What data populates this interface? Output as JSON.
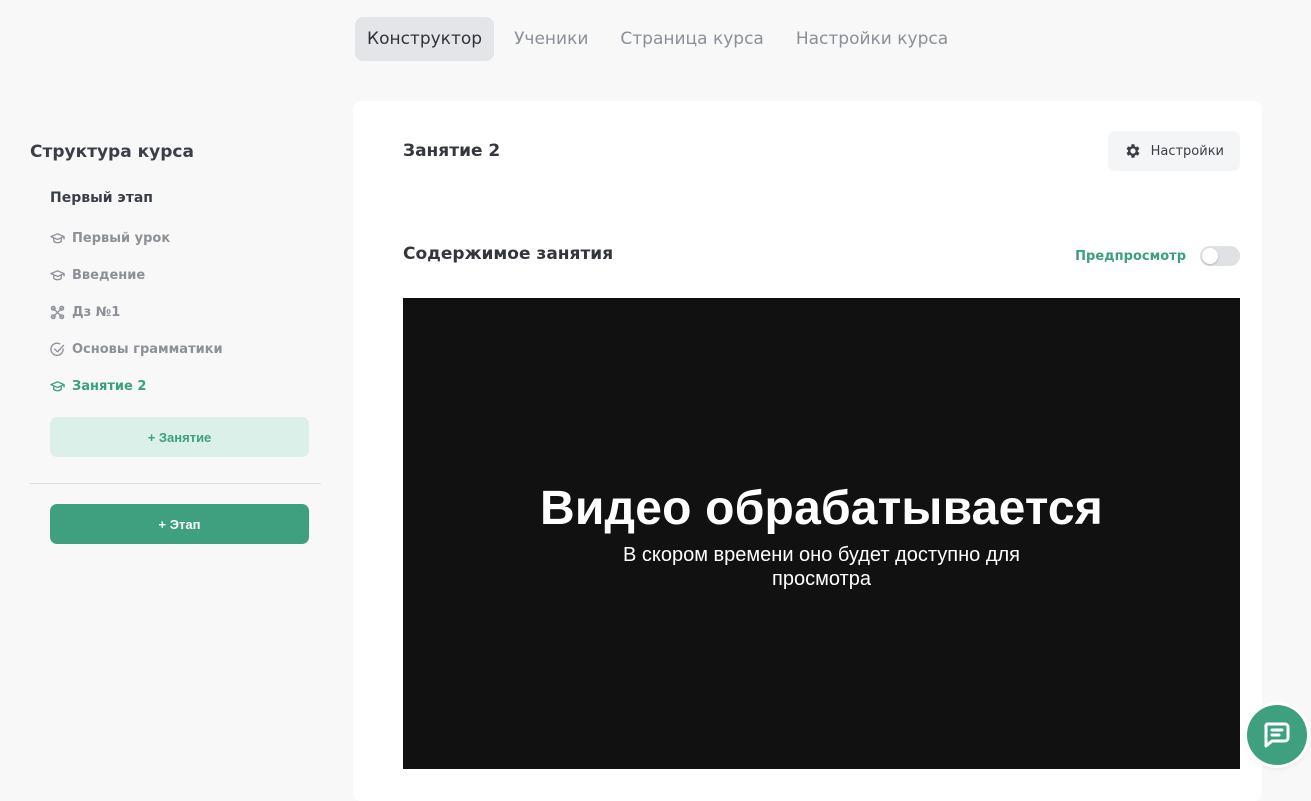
{
  "tabs": [
    {
      "label": "Конструктор",
      "active": true
    },
    {
      "label": "Ученики",
      "active": false
    },
    {
      "label": "Страница курса",
      "active": false
    },
    {
      "label": "Настройки курса",
      "active": false
    }
  ],
  "sidebar": {
    "title": "Структура курса",
    "stage_title": "Первый этап",
    "lessons": [
      {
        "label": "Первый урок",
        "icon": "graduation-cap-icon",
        "active": false
      },
      {
        "label": "Введение",
        "icon": "graduation-cap-icon",
        "active": false
      },
      {
        "label": "Дз №1",
        "icon": "homework-icon",
        "active": false
      },
      {
        "label": "Основы грамматики",
        "icon": "check-circle-icon",
        "active": false
      },
      {
        "label": "Занятие 2",
        "icon": "graduation-cap-icon",
        "active": true
      }
    ],
    "add_lesson_label": "+ Занятие",
    "add_stage_label": "+ Этап"
  },
  "main": {
    "lesson_name": "Занятие 2",
    "settings_label": "Настройки",
    "content_title": "Содержимое занятия",
    "preview_label": "Предпросмотр",
    "preview_enabled": false,
    "video": {
      "title": "Видео обрабатывается",
      "subtitle": "В скором времени оно будет доступно для просмотра"
    }
  },
  "colors": {
    "accent": "#3ea07f",
    "accent_light": "#dcf0ea",
    "video_bg": "#111111"
  }
}
